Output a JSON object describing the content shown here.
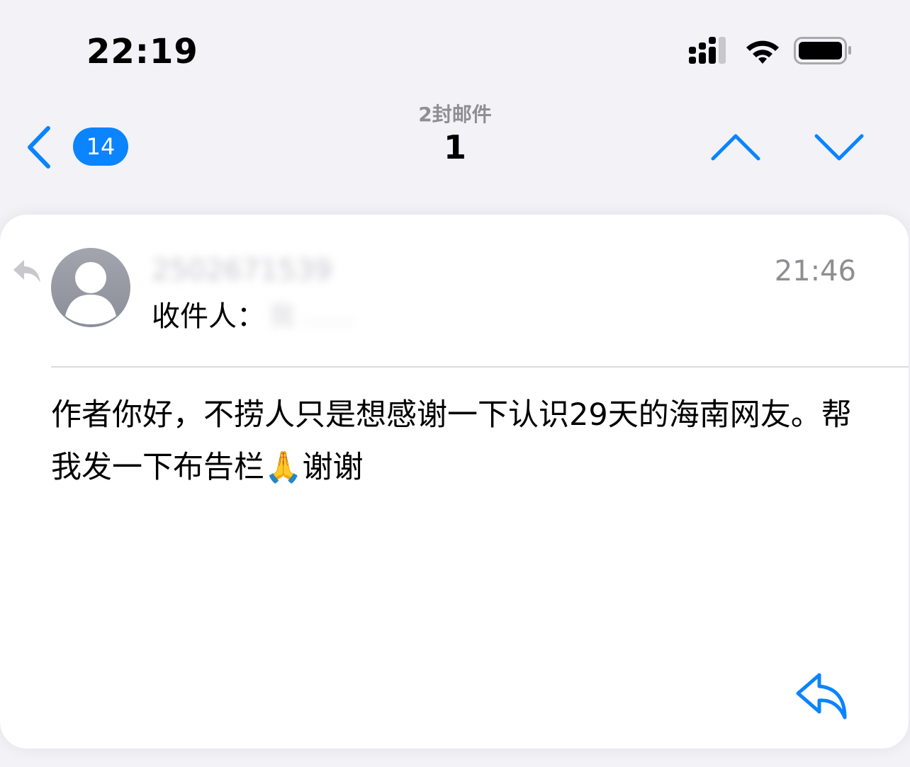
{
  "status_bar": {
    "time": "22:19"
  },
  "nav": {
    "unread_badge": "14",
    "message_count_label": "2封邮件",
    "current_index": "1"
  },
  "message": {
    "sender": "2502671539",
    "time": "21:46",
    "recipient_label": "收件人：",
    "recipient_value": "我 ……",
    "body": "作者你好，不捞人只是想感谢一下认识29天的海南网友。帮我发一下布告栏🙏谢谢"
  },
  "colors": {
    "accent": "#0a84ff",
    "secondary_text": "#8e8e93",
    "background": "#f2f2f7",
    "card": "#ffffff"
  },
  "icons": {
    "back": "chevron-left-icon",
    "previous": "chevron-up-icon",
    "next": "chevron-down-icon",
    "reply": "reply-icon",
    "replied_indicator": "replied-arrow-icon",
    "avatar": "person-icon"
  }
}
